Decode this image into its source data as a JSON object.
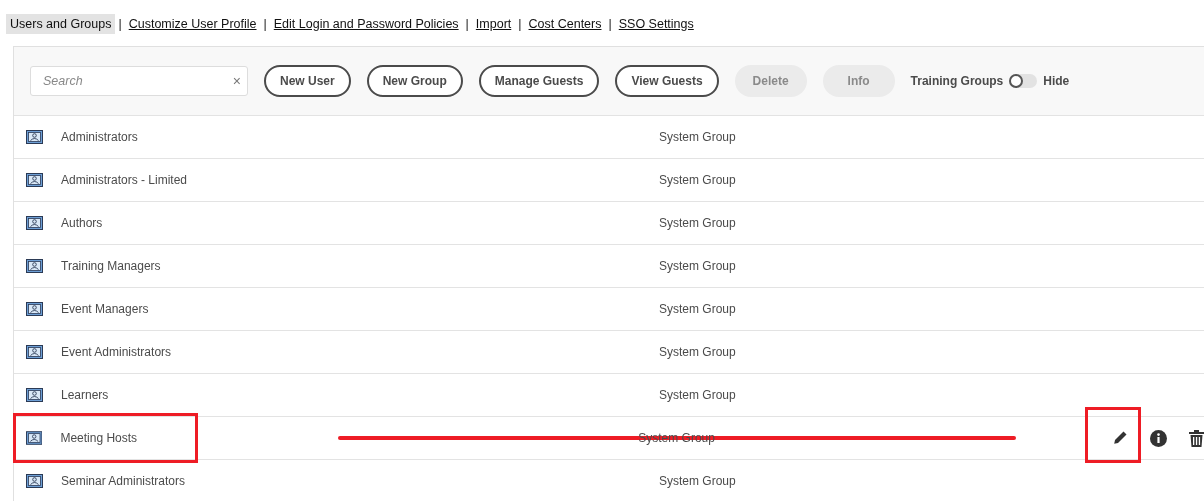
{
  "nav": [
    {
      "label": "Users and Groups",
      "selected": true
    },
    {
      "label": "Customize User Profile",
      "selected": false
    },
    {
      "label": "Edit Login and Password Policies",
      "selected": false
    },
    {
      "label": "Import",
      "selected": false
    },
    {
      "label": "Cost Centers",
      "selected": false
    },
    {
      "label": "SSO Settings",
      "selected": false
    }
  ],
  "separator": "|",
  "search": {
    "placeholder": "Search",
    "clear": "×"
  },
  "buttons": [
    {
      "label": "New User",
      "disabled": false
    },
    {
      "label": "New Group",
      "disabled": false
    },
    {
      "label": "Manage Guests",
      "disabled": false
    },
    {
      "label": "View Guests",
      "disabled": false
    },
    {
      "label": "Delete",
      "disabled": true
    },
    {
      "label": "Info",
      "disabled": true
    }
  ],
  "toggle": {
    "label": "Training Groups",
    "on": false,
    "state_label": "Hide"
  },
  "rows": [
    {
      "name": "Administrators",
      "type": "System Group",
      "actions": false,
      "marked": false
    },
    {
      "name": "Administrators - Limited",
      "type": "System Group",
      "actions": false,
      "marked": false
    },
    {
      "name": "Authors",
      "type": "System Group",
      "actions": false,
      "marked": false
    },
    {
      "name": "Training Managers",
      "type": "System Group",
      "actions": false,
      "marked": false
    },
    {
      "name": "Event Managers",
      "type": "System Group",
      "actions": false,
      "marked": false
    },
    {
      "name": "Event Administrators",
      "type": "System Group",
      "actions": false,
      "marked": false
    },
    {
      "name": "Learners",
      "type": "System Group",
      "actions": false,
      "marked": false
    },
    {
      "name": "Meeting Hosts",
      "type": "System Group",
      "actions": true,
      "marked": true
    },
    {
      "name": "Seminar Administrators",
      "type": "System Group",
      "actions": false,
      "marked": false
    }
  ]
}
